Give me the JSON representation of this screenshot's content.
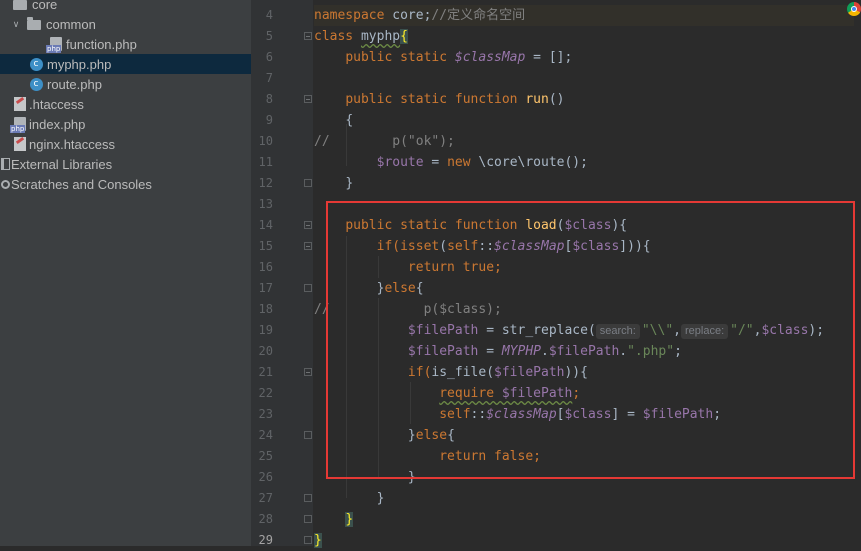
{
  "colors": {
    "highlight_box": "#e53935",
    "selected_row": "#0d293e"
  },
  "project_tree": [
    {
      "label": "core",
      "icon": "folder-icon",
      "depth": 0,
      "expanded": true
    },
    {
      "label": "common",
      "icon": "folder-icon",
      "depth": 1,
      "expanded": true
    },
    {
      "label": "function.php",
      "icon": "php-file-icon",
      "depth": 2
    },
    {
      "label": "myphp.php",
      "icon": "php-class-icon",
      "depth": 1,
      "selected": true
    },
    {
      "label": "route.php",
      "icon": "php-class-icon",
      "depth": 1
    },
    {
      "label": ".htaccess",
      "icon": "htaccess-file-icon",
      "depth": 0
    },
    {
      "label": "index.php",
      "icon": "php-file-icon",
      "depth": 0
    },
    {
      "label": "nginx.htaccess",
      "icon": "htaccess-file-icon",
      "depth": 0
    },
    {
      "label": "External Libraries",
      "icon": "libraries-icon",
      "depth": -1
    },
    {
      "label": "Scratches and Consoles",
      "icon": "scratches-icon",
      "depth": -1
    }
  ],
  "editor": {
    "line_numbers": [
      "4",
      "5",
      "6",
      "7",
      "8",
      "9",
      "10",
      "11",
      "12",
      "13",
      "14",
      "15",
      "16",
      "17",
      "18",
      "19",
      "20",
      "21",
      "22",
      "23",
      "24",
      "25",
      "26",
      "27",
      "28",
      "29"
    ],
    "current_line": "29",
    "hint_search": "search:",
    "hint_replace": "replace:",
    "t": {
      "ns_kw": "namespace",
      "ns_name": " core;",
      "ns_cmt": "//定义命名空间",
      "class_kw": "class ",
      "class_name": "myphp",
      "brace_open": "{",
      "l6_kw": "public static ",
      "l6_var": "$classMap",
      "l6_rest": " = [];",
      "l8_kw": "public static function ",
      "l8_fn": "run",
      "l8_rest": "()",
      "l9": "{",
      "l10": "//        p(\"ok\");",
      "l11_var": "$route",
      "l11_eq": " = ",
      "l11_new": "new ",
      "l11_rest": "\\core\\route();",
      "l12": "}",
      "l14_kw": "public static function ",
      "l14_fn": "load",
      "l14_p1": "(",
      "l14_var": "$class",
      "l14_p2": "){",
      "l15_if": "if(",
      "l15_isset": "isset",
      "l15_p": "(",
      "l15_self": "self",
      "l15_dc": "::",
      "l15_map": "$classMap",
      "l15_b1": "[",
      "l15_var": "$class",
      "l15_end": "])){",
      "l16_kw": "return true",
      "l16_semi": ";",
      "l17_a": "}",
      "l17_kw": "else",
      "l17_b": "{",
      "l18": "//            p($class);",
      "l19_var": "$filePath",
      "l19_mid": " = str_replace(",
      "l19_s1": "\"\\\\\"",
      "l19_c1": ",",
      "l19_s2": "\"/\"",
      "l19_c2": ",",
      "l19_var2": "$class",
      "l19_end": ");",
      "l20_var": "$filePath",
      "l20_eq": " = ",
      "l20_const": "MYPHP",
      "l20_dot": ".",
      "l20_var2": "$filePath",
      "l20_dot2": ".",
      "l20_str": "\".php\"",
      "l20_semi": ";",
      "l21_if": "if(",
      "l21_fn": "is_file(",
      "l21_var": "$filePath",
      "l21_end": ")){",
      "l22_kw": "require ",
      "l22_var": "$filePath",
      "l22_semi": ";",
      "l23_self": "self",
      "l23_dc": "::",
      "l23_map": "$classMap",
      "l23_b1": "[",
      "l23_var": "$class",
      "l23_b2": "] = ",
      "l23_var2": "$filePath",
      "l23_semi": ";",
      "l24_a": "}",
      "l24_kw": "else",
      "l24_b": "{",
      "l25_kw": "return false",
      "l25_semi": ";",
      "l26": "}",
      "l27": "}",
      "l28": "}",
      "l29": "}"
    }
  }
}
